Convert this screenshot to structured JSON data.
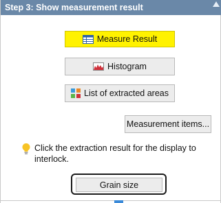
{
  "panel": {
    "title": "Step 3: Show measurement result",
    "buttons": {
      "measure_result": "Measure Result",
      "histogram": "Histogram",
      "list_extracted": "List of extracted areas",
      "measurement_items": "Measurement items...",
      "grain_size": "Grain size"
    },
    "tip": "Click the extraction result for the display to interlock."
  },
  "colors": {
    "title_bar": "#6a88a8",
    "active_button": "#fff200",
    "accent": "#3b8ad8"
  },
  "icons": [
    "table-icon",
    "histogram-icon",
    "extracted-areas-icon",
    "lightbulb-icon",
    "collapse-triangle-icon"
  ]
}
